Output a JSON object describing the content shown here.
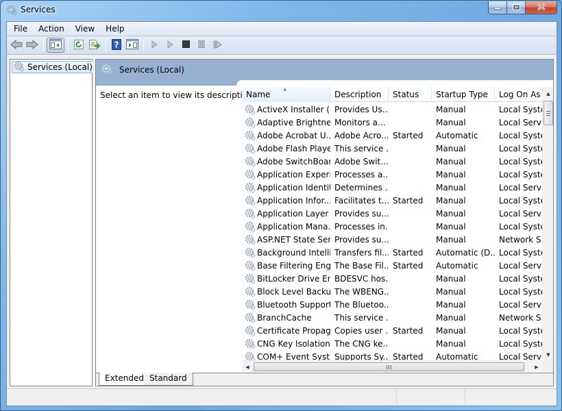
{
  "window": {
    "title": "Services",
    "icon": "services-gear-icon",
    "controls": [
      "minimize",
      "maximize",
      "close"
    ]
  },
  "menubar": {
    "items": [
      "File",
      "Action",
      "View",
      "Help"
    ]
  },
  "toolbar": {
    "buttons": [
      {
        "name": "back",
        "icon": "arrow-left-icon",
        "enabled": true
      },
      {
        "name": "forward",
        "icon": "arrow-right-icon",
        "enabled": true
      },
      {
        "name": "show-hide-console-tree",
        "icon": "console-tree-icon",
        "active": true
      },
      {
        "name": "refresh",
        "icon": "refresh-icon",
        "enabled": true
      },
      {
        "name": "export-list",
        "icon": "export-list-icon",
        "enabled": true
      },
      {
        "name": "help",
        "icon": "help-icon",
        "enabled": true
      },
      {
        "name": "show-hide-action-pane",
        "icon": "action-pane-icon",
        "enabled": true
      },
      {
        "name": "start-service",
        "icon": "play-icon",
        "enabled": false
      },
      {
        "name": "start-service-alt",
        "icon": "play-outline-icon",
        "enabled": false
      },
      {
        "name": "stop-service",
        "icon": "stop-icon",
        "enabled": false
      },
      {
        "name": "pause-service",
        "icon": "pause-icon",
        "enabled": false
      },
      {
        "name": "restart-service",
        "icon": "restart-icon",
        "enabled": false
      }
    ]
  },
  "tree": {
    "items": [
      {
        "label": "Services (Local)",
        "selected": true
      }
    ]
  },
  "main": {
    "header_title": "Services (Local)",
    "description_hint": "Select an item to view its description.",
    "columns": [
      "Name",
      "Description",
      "Status",
      "Startup Type",
      "Log On As"
    ],
    "sorted_column": "Name",
    "rows": [
      [
        "ActiveX Installer (...",
        "Provides Us...",
        "",
        "Manual",
        "Local Syste..."
      ],
      [
        "Adaptive Brightness",
        "Monitors a...",
        "",
        "Manual",
        "Local Servic"
      ],
      [
        "Adobe Acrobat U...",
        "Adobe Acro...",
        "Started",
        "Automatic",
        "Local Syste..."
      ],
      [
        "Adobe Flash Playe...",
        "This service ...",
        "",
        "Manual",
        "Local Syste..."
      ],
      [
        "Adobe SwitchBoard",
        "Adobe Swit...",
        "",
        "Manual",
        "Local Syste..."
      ],
      [
        "Application Experi...",
        "Processes a...",
        "",
        "Manual",
        "Local Syste..."
      ],
      [
        "Application Identity",
        "Determines ...",
        "",
        "Manual",
        "Local Servic"
      ],
      [
        "Application Infor...",
        "Facilitates t...",
        "Started",
        "Manual",
        "Local Syste..."
      ],
      [
        "Application Layer ...",
        "Provides su...",
        "",
        "Manual",
        "Local Servic"
      ],
      [
        "Application Mana...",
        "Processes in...",
        "",
        "Manual",
        "Local Syste..."
      ],
      [
        "ASP.NET State Ser...",
        "Provides su...",
        "",
        "Manual",
        "Network S..."
      ],
      [
        "Background Intelli...",
        "Transfers fil...",
        "Started",
        "Automatic (D...",
        "Local Syste..."
      ],
      [
        "Base Filtering Engi...",
        "The Base Fil...",
        "Started",
        "Automatic",
        "Local Servic"
      ],
      [
        "BitLocker Drive En...",
        "BDESVC hos...",
        "",
        "Manual",
        "Local Syste..."
      ],
      [
        "Block Level Backu...",
        "The WBENG...",
        "",
        "Manual",
        "Local Syste..."
      ],
      [
        "Bluetooth Support...",
        "The Bluetoo...",
        "",
        "Manual",
        "Local Servic"
      ],
      [
        "BranchCache",
        "This service ...",
        "",
        "Manual",
        "Network S..."
      ],
      [
        "Certificate Propag...",
        "Copies user ...",
        "Started",
        "Manual",
        "Local Syste..."
      ],
      [
        "CNG Key Isolation",
        "The CNG ke...",
        "",
        "Manual",
        "Local Syste..."
      ],
      [
        "COM+ Event Syst...",
        "Supports Sy...",
        "Started",
        "Automatic",
        "Local Servic"
      ]
    ],
    "tabs": [
      {
        "label": "Extended",
        "active": true
      },
      {
        "label": "Standard",
        "active": false
      }
    ]
  },
  "colors": {
    "header_band": "#97b2d1",
    "title_glass": "#7db7ea",
    "close_button": "#c2442c"
  }
}
